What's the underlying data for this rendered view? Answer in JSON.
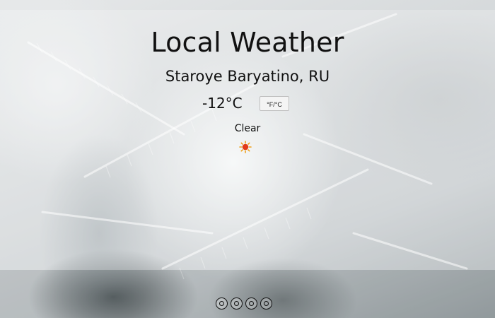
{
  "header": {
    "title": "Local Weather"
  },
  "weather": {
    "location": "Staroye Baryatino, RU",
    "temperature": "-12°C",
    "unit_toggle_label": "°F/°C",
    "condition": "Clear",
    "condition_icon": "sun-icon"
  },
  "social_links": [
    {
      "icon": "social-link-icon"
    },
    {
      "icon": "social-link-icon"
    },
    {
      "icon": "social-link-icon"
    },
    {
      "icon": "social-link-icon"
    }
  ],
  "colors": {
    "text": "#111111",
    "sun_core": "#e23b1a",
    "sun_rays": "#f0a21a"
  }
}
